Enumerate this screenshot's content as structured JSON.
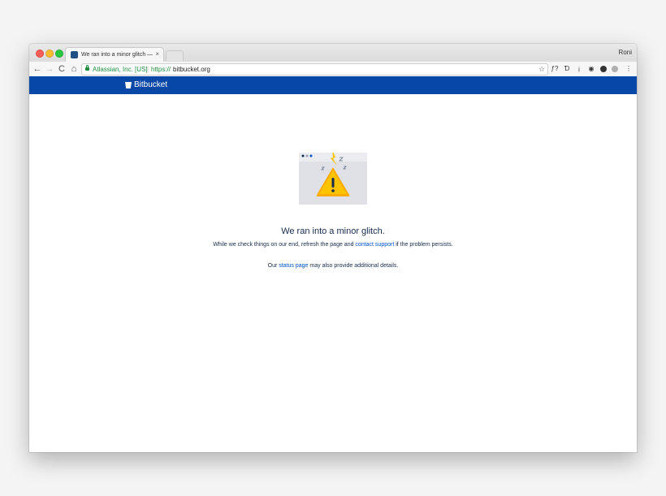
{
  "browser": {
    "tab_title": "We ran into a minor glitch — B",
    "tab_close": "×",
    "user_name": "Roni",
    "nav": {
      "back": "←",
      "forward": "→",
      "reload": "C",
      "home": "⌂"
    },
    "address": {
      "cert_org": "Atlassian, Inc. [US]",
      "separator": "|",
      "scheme": "https://",
      "host": "bitbucket.org",
      "star": "☆"
    },
    "extensions": [
      {
        "label": "ƒ?"
      },
      {
        "label": "Ɗ"
      },
      {
        "label": "¡"
      },
      {
        "label": "◉"
      }
    ],
    "menu": "⋮"
  },
  "app": {
    "name": "Bitbucket",
    "brand_color": "#0747a6"
  },
  "error": {
    "heading": "We ran into a minor glitch.",
    "line1_prefix": "While we check things on our end, refresh the page and ",
    "line1_link": "contact support",
    "line1_suffix": " if the problem persists.",
    "line2_prefix": "Our ",
    "line2_link": "status page",
    "line2_suffix": " may also provide additional details."
  }
}
